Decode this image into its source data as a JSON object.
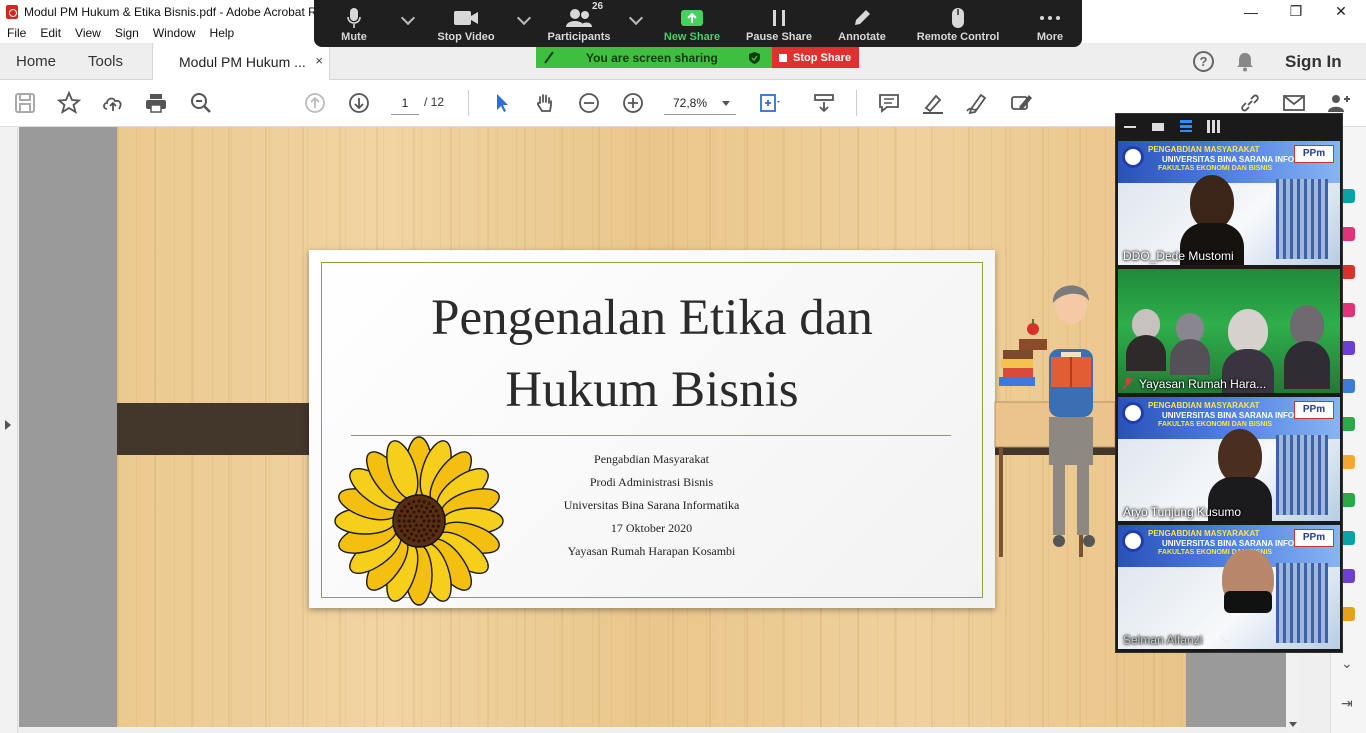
{
  "window": {
    "title": "Modul PM Hukum & Etika Bisnis.pdf - Adobe Acrobat R",
    "minimize_glyph": "—",
    "maximize_glyph": "❐",
    "close_glyph": "✕"
  },
  "menu": [
    "File",
    "Edit",
    "View",
    "Sign",
    "Window",
    "Help"
  ],
  "tabs": {
    "home": "Home",
    "tools": "Tools",
    "document": "Modul PM Hukum ...",
    "close_glyph": "×"
  },
  "header_right": {
    "help_glyph": "?",
    "sign_in": "Sign In"
  },
  "toolbar": {
    "page_current": "1",
    "page_total": "/ 12",
    "zoom": "72,8%"
  },
  "zoom_controls": {
    "mute": "Mute",
    "stop_video": "Stop Video",
    "participants": "Participants",
    "participants_count": "26",
    "new_share": "New Share",
    "pause_share": "Pause Share",
    "annotate": "Annotate",
    "remote_control": "Remote Control",
    "more": "More",
    "sharing_status": "You are screen sharing",
    "stop_share": "Stop Share"
  },
  "slide": {
    "title_line1": "Pengenalan Etika dan",
    "title_line2": "Hukum Bisnis",
    "info": [
      "Pengabdian Masyarakat",
      "Prodi Administrasi Bisnis",
      "Universitas Bina Sarana Informatika",
      "17 Oktober 2020",
      "Yayasan Rumah Harapan Kosambi"
    ]
  },
  "video_tiles": {
    "banner": {
      "line1": "PENGABDIAN MASYARAKAT",
      "line2": "UNIVERSITAS BINA SARANA INFORMATIKA",
      "line3": "FAKULTAS EKONOMI DAN BISNIS",
      "logo_right": "PPm"
    },
    "tile1_name": "DDO_Dede Mustomi",
    "tile2_name": "Yayasan Rumah Hara...",
    "tile3_name": "Aryo Tunjung Kusumo",
    "tile4_name": "Selman Alfanzi"
  },
  "colors": {
    "accent_green": "#44d15e",
    "stop_red": "#e0302f",
    "acrobat_red": "#d9261c",
    "frame_green": "#8aa33a",
    "band_brown": "#43372c"
  }
}
